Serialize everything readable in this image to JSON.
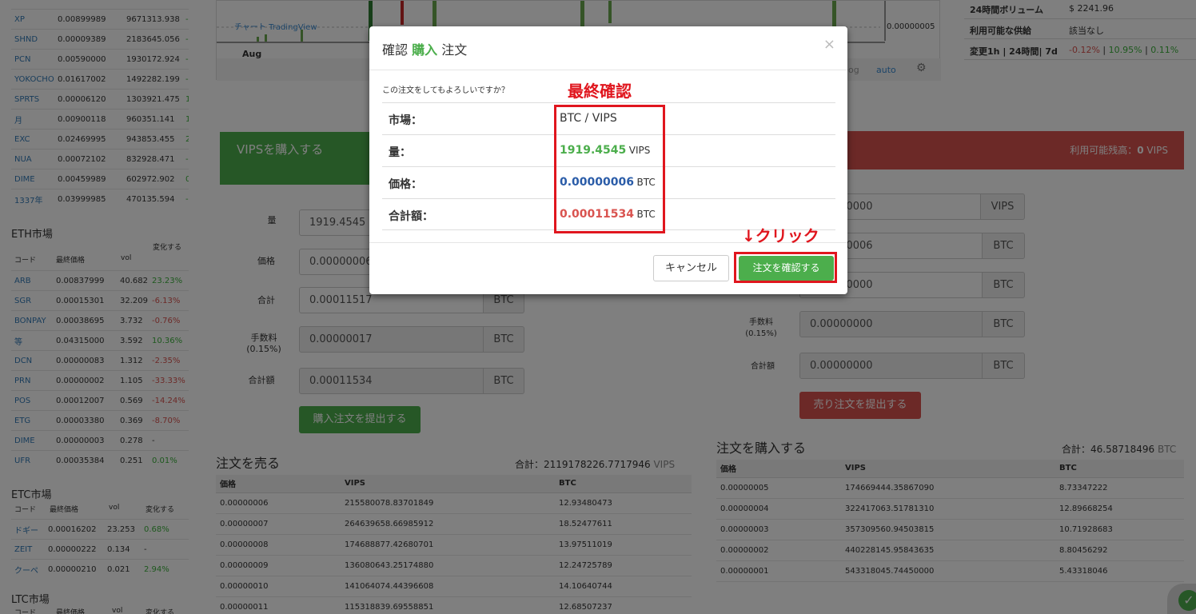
{
  "btc_markets": [
    {
      "code": "XP",
      "price": "0.00899989",
      "vol": "9671313.938",
      "chg": "-"
    },
    {
      "code": "SHND",
      "price": "0.00009389",
      "vol": "2183645.056",
      "chg": "-"
    },
    {
      "code": "PCN",
      "price": "0.00590000",
      "vol": "1930172.924",
      "chg": "-"
    },
    {
      "code": "YOKOCHO",
      "price": "0.01617002",
      "vol": "1492282.199",
      "chg": "-"
    },
    {
      "code": "SPRTS",
      "price": "0.00006120",
      "vol": "1303921.475",
      "chg": "1"
    },
    {
      "code": "月",
      "price": "0.00900118",
      "vol": "960351.141",
      "chg": "1"
    },
    {
      "code": "EXC",
      "price": "0.02469995",
      "vol": "943853.455",
      "chg": "2"
    },
    {
      "code": "NUA",
      "price": "0.00072102",
      "vol": "832928.471",
      "chg": "-"
    },
    {
      "code": "DIME",
      "price": "0.00459989",
      "vol": "602972.902",
      "chg": "0"
    },
    {
      "code": "1337年",
      "price": "0.03999985",
      "vol": "470135.594",
      "chg": "-"
    }
  ],
  "eth": {
    "title": "ETH市場",
    "col_code": "コード",
    "col_price": "最終価格",
    "col_vol": "vol",
    "col_chg": "変化する",
    "rows": [
      {
        "code": "ARB",
        "price": "0.00837999",
        "vol": "40.682",
        "chg": "23.23%",
        "dir": "pos"
      },
      {
        "code": "SGR",
        "price": "0.00015301",
        "vol": "32.209",
        "chg": "-6.13%",
        "dir": "neg"
      },
      {
        "code": "BONPAY",
        "price": "0.00038695",
        "vol": "3.732",
        "chg": "-0.76%",
        "dir": "neg"
      },
      {
        "code": "等",
        "price": "0.04315000",
        "vol": "3.592",
        "chg": "10.36%",
        "dir": "pos"
      },
      {
        "code": "DCN",
        "price": "0.00000083",
        "vol": "1.312",
        "chg": "-2.35%",
        "dir": "neg"
      },
      {
        "code": "PRN",
        "price": "0.00000002",
        "vol": "1.105",
        "chg": "-33.33%",
        "dir": "neg"
      },
      {
        "code": "POS",
        "price": "0.00012007",
        "vol": "0.569",
        "chg": "-14.24%",
        "dir": "neg"
      },
      {
        "code": "ETG",
        "price": "0.00003380",
        "vol": "0.369",
        "chg": "-8.70%",
        "dir": "neg"
      },
      {
        "code": "DIME",
        "price": "0.00000003",
        "vol": "0.278",
        "chg": "-",
        "dir": ""
      },
      {
        "code": "UFR",
        "price": "0.00035384",
        "vol": "0.251",
        "chg": "0.01%",
        "dir": "pos"
      }
    ]
  },
  "etc": {
    "title": "ETC市場",
    "col_code": "コード",
    "col_price": "最終価格",
    "col_vol": "vol",
    "col_chg": "変化する",
    "rows": [
      {
        "code": "ドギー",
        "price": "0.00016202",
        "vol": "23.253",
        "chg": "0.68%",
        "dir": "pos"
      },
      {
        "code": "ZEIT",
        "price": "0.00000222",
        "vol": "0.134",
        "chg": "-",
        "dir": ""
      },
      {
        "code": "クーペ",
        "price": "0.00000210",
        "vol": "0.021",
        "chg": "2.94%",
        "dir": "pos"
      }
    ]
  },
  "ltc": {
    "title": "LTC市場",
    "col_code": "コード",
    "col_price": "最終価格",
    "col_vol": "vol",
    "col_chg": "変化する"
  },
  "chart": {
    "month": "Aug",
    "price_label": "0.00000005",
    "watermark": "チャート TradingView",
    "log": "log",
    "auto": "auto"
  },
  "stats": {
    "vol_label": "24時間ボリューム",
    "vol_value": "$ 2241.96",
    "supply_label": "利用可能な供給",
    "supply_value": "該当なし",
    "change_label": "変更1h | 24時間| 7d",
    "change_1h": "-0.12%",
    "change_24h": "10.95%",
    "change_7d": "0.11%"
  },
  "buy": {
    "title": "VIPSを購入する",
    "labels": {
      "amount": "量",
      "price": "価格",
      "total": "合計",
      "fee": "手数料",
      "fee_pct": "(0.15%)",
      "grand": "合計額"
    },
    "amount": "1919.4545",
    "price": "0.00000006",
    "total": "0.00011517",
    "fee": "0.00000017",
    "grand": "0.00011534",
    "unit": "BTC",
    "button": "購入注文を提出する"
  },
  "sell": {
    "avail_label": "利用可能残高：",
    "avail_value": "0",
    "avail_unit": "VIPS",
    "labels": {
      "fee": "手数料",
      "fee_pct": "(0.15%)",
      "grand": "合計額"
    },
    "amount": "0.00000000",
    "amount_unit": "VIPS",
    "price": "0.00000006",
    "total": "0.00000000",
    "fee": "0.00000000",
    "grand": "0.00000000",
    "unit": "BTC",
    "button": "売り注文を提出する"
  },
  "sell_orders": {
    "title": "注文を売る",
    "total_label": "合計：",
    "total_value": "2119178226.7717946",
    "total_unit": "VIPS",
    "col1": "価格",
    "col2": "VIPS",
    "col3": "BTC",
    "rows": [
      [
        "0.00000006",
        "215580078.83701849",
        "12.93480473"
      ],
      [
        "0.00000007",
        "264639658.66985912",
        "18.52477611"
      ],
      [
        "0.00000008",
        "174688877.42680701",
        "13.97511019"
      ],
      [
        "0.00000009",
        "136080643.25174880",
        "12.24725789"
      ],
      [
        "0.00000010",
        "141064074.44396608",
        "14.10640744"
      ],
      [
        "0.00000011",
        "115318839.69558851",
        "12.68507237"
      ]
    ]
  },
  "buy_orders": {
    "title": "注文を購入する",
    "total_label": "合計：",
    "total_value": "46.58718496",
    "total_unit": "BTC",
    "col1": "価格",
    "col2": "VIPS",
    "col3": "BTC",
    "rows": [
      [
        "0.00000005",
        "174669444.35867090",
        "8.73347222"
      ],
      [
        "0.00000004",
        "322417063.51781310",
        "12.89668254"
      ],
      [
        "0.00000003",
        "357309560.94503815",
        "10.71928683"
      ],
      [
        "0.00000002",
        "440228145.95843635",
        "8.80456292"
      ],
      [
        "0.00000001",
        "543318045.74450000",
        "5.43318046"
      ]
    ]
  },
  "modal": {
    "title_pre": "確認",
    "title_action": "購入",
    "title_post": "注文",
    "close": "×",
    "question": "この注文をしてもよろしいですか？",
    "market_label": "市場：",
    "market_value": "BTC / VIPS",
    "amount_label": "量：",
    "amount_value": "1919.4545",
    "amount_unit": "VIPS",
    "price_label": "価格：",
    "price_value": "0.00000006",
    "price_unit": "BTC",
    "total_label": "合計額：",
    "total_value": "0.00011534",
    "total_unit": "BTC",
    "cancel": "キャンセル",
    "confirm": "注文を確認する"
  },
  "annotations": {
    "final": "最終確認",
    "click": "↓クリック"
  },
  "colors": {
    "green": "#4cae4c",
    "red": "#d9534f",
    "annot": "#e0161e",
    "blue": "#2a5ca8"
  }
}
